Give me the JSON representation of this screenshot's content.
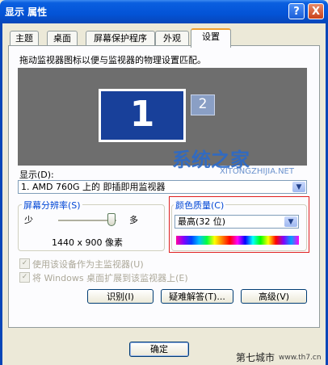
{
  "window": {
    "title": "显示 属性",
    "help_button": "?",
    "close_button": "X"
  },
  "tabs": [
    {
      "label": "主题"
    },
    {
      "label": "桌面"
    },
    {
      "label": "屏幕保护程序"
    },
    {
      "label": "外观"
    },
    {
      "label": "设置",
      "active": true
    }
  ],
  "settings": {
    "instruction": "拖动监视器图标以便与监视器的物理设置匹配。",
    "monitor1_label": "1",
    "monitor2_label": "2",
    "display_label": "显示(D):",
    "display_value": "1. AMD 760G 上的 即插即用监视器",
    "resolution": {
      "group_label": "屏幕分辨率(S)",
      "less_label": "少",
      "more_label": "多",
      "value": "1440 x 900 像素",
      "slider_level": 1.0
    },
    "color_quality": {
      "group_label": "颜色质量(C)",
      "value": "最高(32 位)"
    },
    "primary_checkbox": {
      "label": "使用该设备作为主监视器(U)",
      "checked": true,
      "enabled": false
    },
    "extend_checkbox": {
      "label": "将 Windows 桌面扩展到该监视器上(E)",
      "checked": true,
      "enabled": false
    },
    "buttons": {
      "identify": "识别(I)",
      "troubleshoot": "疑难解答(T)...",
      "advanced": "高级(V)"
    }
  },
  "footer": {
    "ok_button": "确定"
  },
  "watermarks": {
    "site_name": "系统之家",
    "site_url": "XITONGZHIJIA.NET",
    "corner_name": "第七城市",
    "corner_url": "www.th7.cn"
  },
  "colors": {
    "title_bar": "#0353d6",
    "tab_highlight": "#f0a030",
    "group_label": "#0046d5",
    "desktop_preview": "#6e6e6e",
    "monitor_primary": "#18409a",
    "highlight_box": "#e02020"
  }
}
